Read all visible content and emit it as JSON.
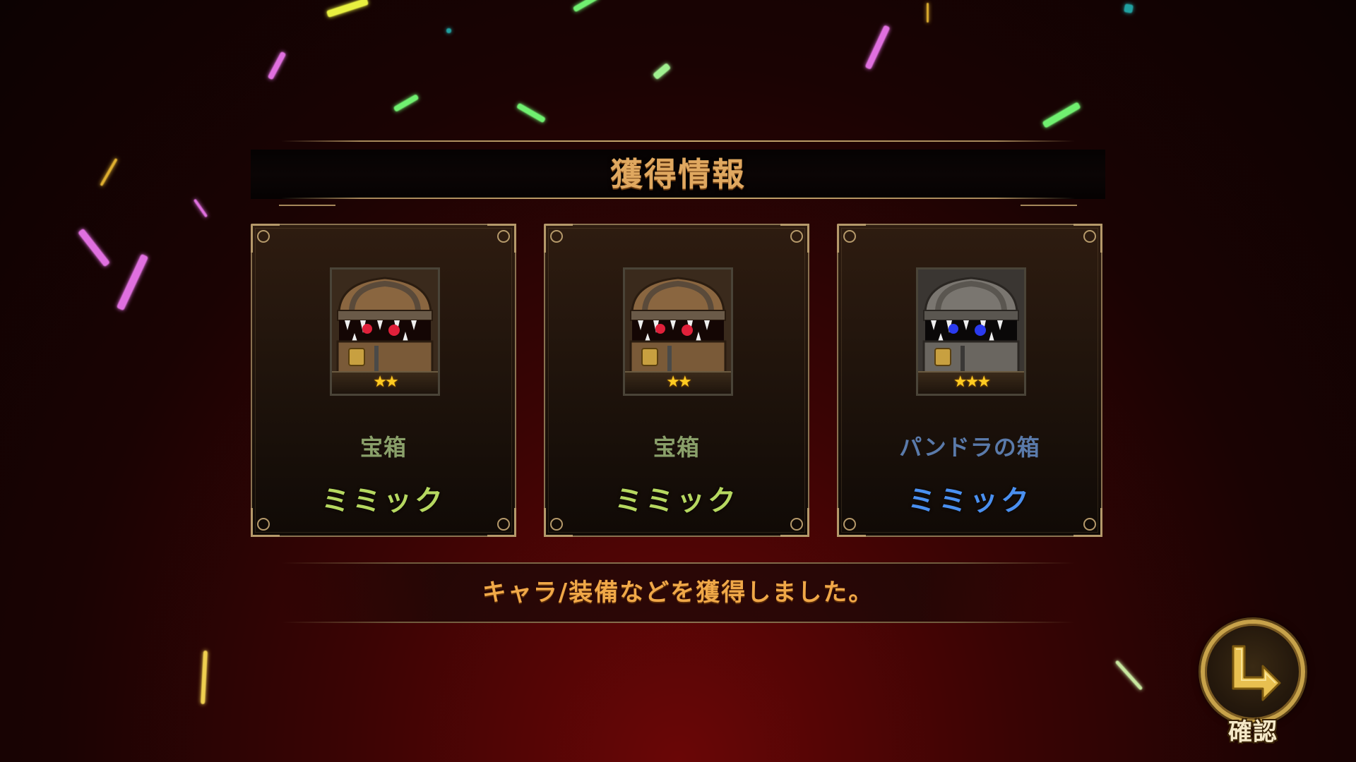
{
  "header": {
    "title": "獲得情報"
  },
  "rewards": [
    {
      "type": "宝箱",
      "name": "ミミック",
      "stars": 2,
      "star_text": "★★",
      "eye_color": "#e0203a",
      "body_color": "#7a5a38"
    },
    {
      "type": "宝箱",
      "name": "ミミック",
      "stars": 2,
      "star_text": "★★",
      "eye_color": "#e0203a",
      "body_color": "#7a5a38"
    },
    {
      "type": "パンドラの箱",
      "name": "ミミック",
      "stars": 3,
      "star_text": "★★★",
      "eye_color": "#2a3aee",
      "body_color": "#6a6660"
    }
  ],
  "footer": {
    "message": "キャラ/装備などを獲得しました。"
  },
  "confirm_button": {
    "label": "確認",
    "icon": "return-arrow-icon"
  },
  "colors": {
    "accent_gold": "#e0a860",
    "rarity_2_name": "#b6d860",
    "rarity_3_name": "#4a90f0",
    "background": "#3a0404"
  }
}
